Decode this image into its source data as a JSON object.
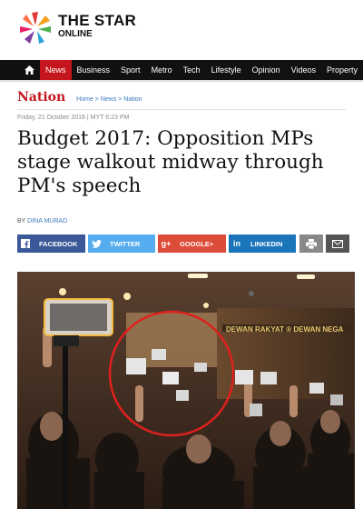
{
  "brand": {
    "title": "THE STAR",
    "subtitle": "ONLINE"
  },
  "nav": {
    "items": [
      "News",
      "Business",
      "Sport",
      "Metro",
      "Tech",
      "Lifestyle",
      "Opinion",
      "Videos",
      "Property"
    ],
    "active": "News"
  },
  "section": {
    "title": "Nation",
    "breadcrumb": "Home > News > Nation"
  },
  "article": {
    "dateline": "Friday, 21 October 2016 | MYT 6:23 PM",
    "headline": "Budget 2017: Opposition MPs stage walkout midway through PM's speech",
    "byline_prefix": "BY",
    "author": "DINA MURAD"
  },
  "share": {
    "facebook": "FACEBOOK",
    "twitter": "TWITTER",
    "googleplus": "GOOGLE+",
    "linkedin": "LINKEDIN"
  },
  "photo": {
    "wall_sign": "DEWAN RAKYAT ® DEWAN NEGA"
  },
  "colors": {
    "accent": "#c4161c",
    "facebook": "#3b5998",
    "twitter": "#55acee",
    "googleplus": "#dd4b39",
    "linkedin": "#1b75bb"
  }
}
